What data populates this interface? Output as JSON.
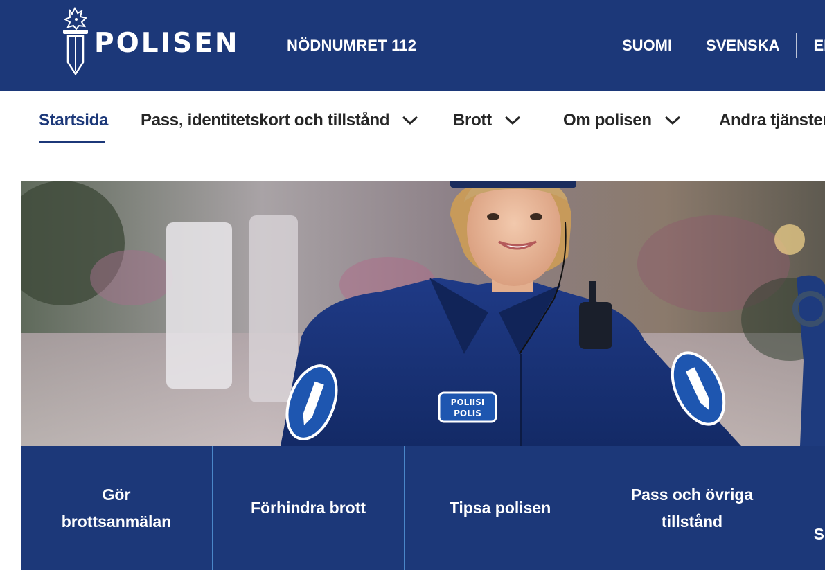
{
  "header": {
    "logo_text": "POLISEN",
    "emergency": "NÖDNUMRET 112",
    "languages": [
      "SUOMI",
      "SVENSKA",
      "ENG"
    ]
  },
  "nav": {
    "items": [
      {
        "label": "Startsida",
        "active": true
      },
      {
        "label": "Pass, identitetskort och tillstånd",
        "dropdown": true
      },
      {
        "label": "Brott",
        "dropdown": true
      },
      {
        "label": "Om polisen",
        "dropdown": true
      },
      {
        "label": "Andra tjänster"
      }
    ]
  },
  "hero": {
    "badge_line1": "POLIISI",
    "badge_line2": "POLIS"
  },
  "tiles": [
    {
      "line1": "Gör",
      "line2": "brottsanmälan"
    },
    {
      "line1": "Förhindra brott",
      "line2": ""
    },
    {
      "line1": "Tipsa polisen",
      "line2": ""
    },
    {
      "line1": "Pass och övriga",
      "line2": "tillstånd"
    },
    {
      "line1": "S",
      "line2": ""
    }
  ],
  "colors": {
    "brand_blue": "#1c3879",
    "divider_blue": "#4a86c8",
    "nav_text": "#262626"
  },
  "icons": [
    "police-emblem-icon",
    "chevron-down-icon"
  ]
}
